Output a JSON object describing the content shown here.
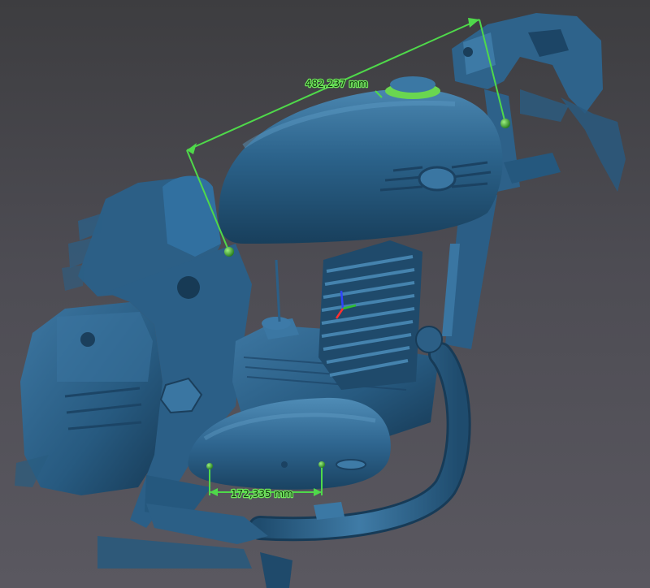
{
  "viewer": {
    "background_top": "#3d3d40",
    "background_bottom": "#5a5860",
    "model_color": "#2f6488",
    "measure_color": "#4fd94a"
  },
  "measurements": [
    {
      "label": "482,237 mm",
      "target": "fuel-tank-to-steering-head"
    },
    {
      "label": "172,335 mm",
      "target": "side-cover"
    }
  ],
  "icons": {
    "axis_gizmo": "xyz-axis-icon"
  }
}
